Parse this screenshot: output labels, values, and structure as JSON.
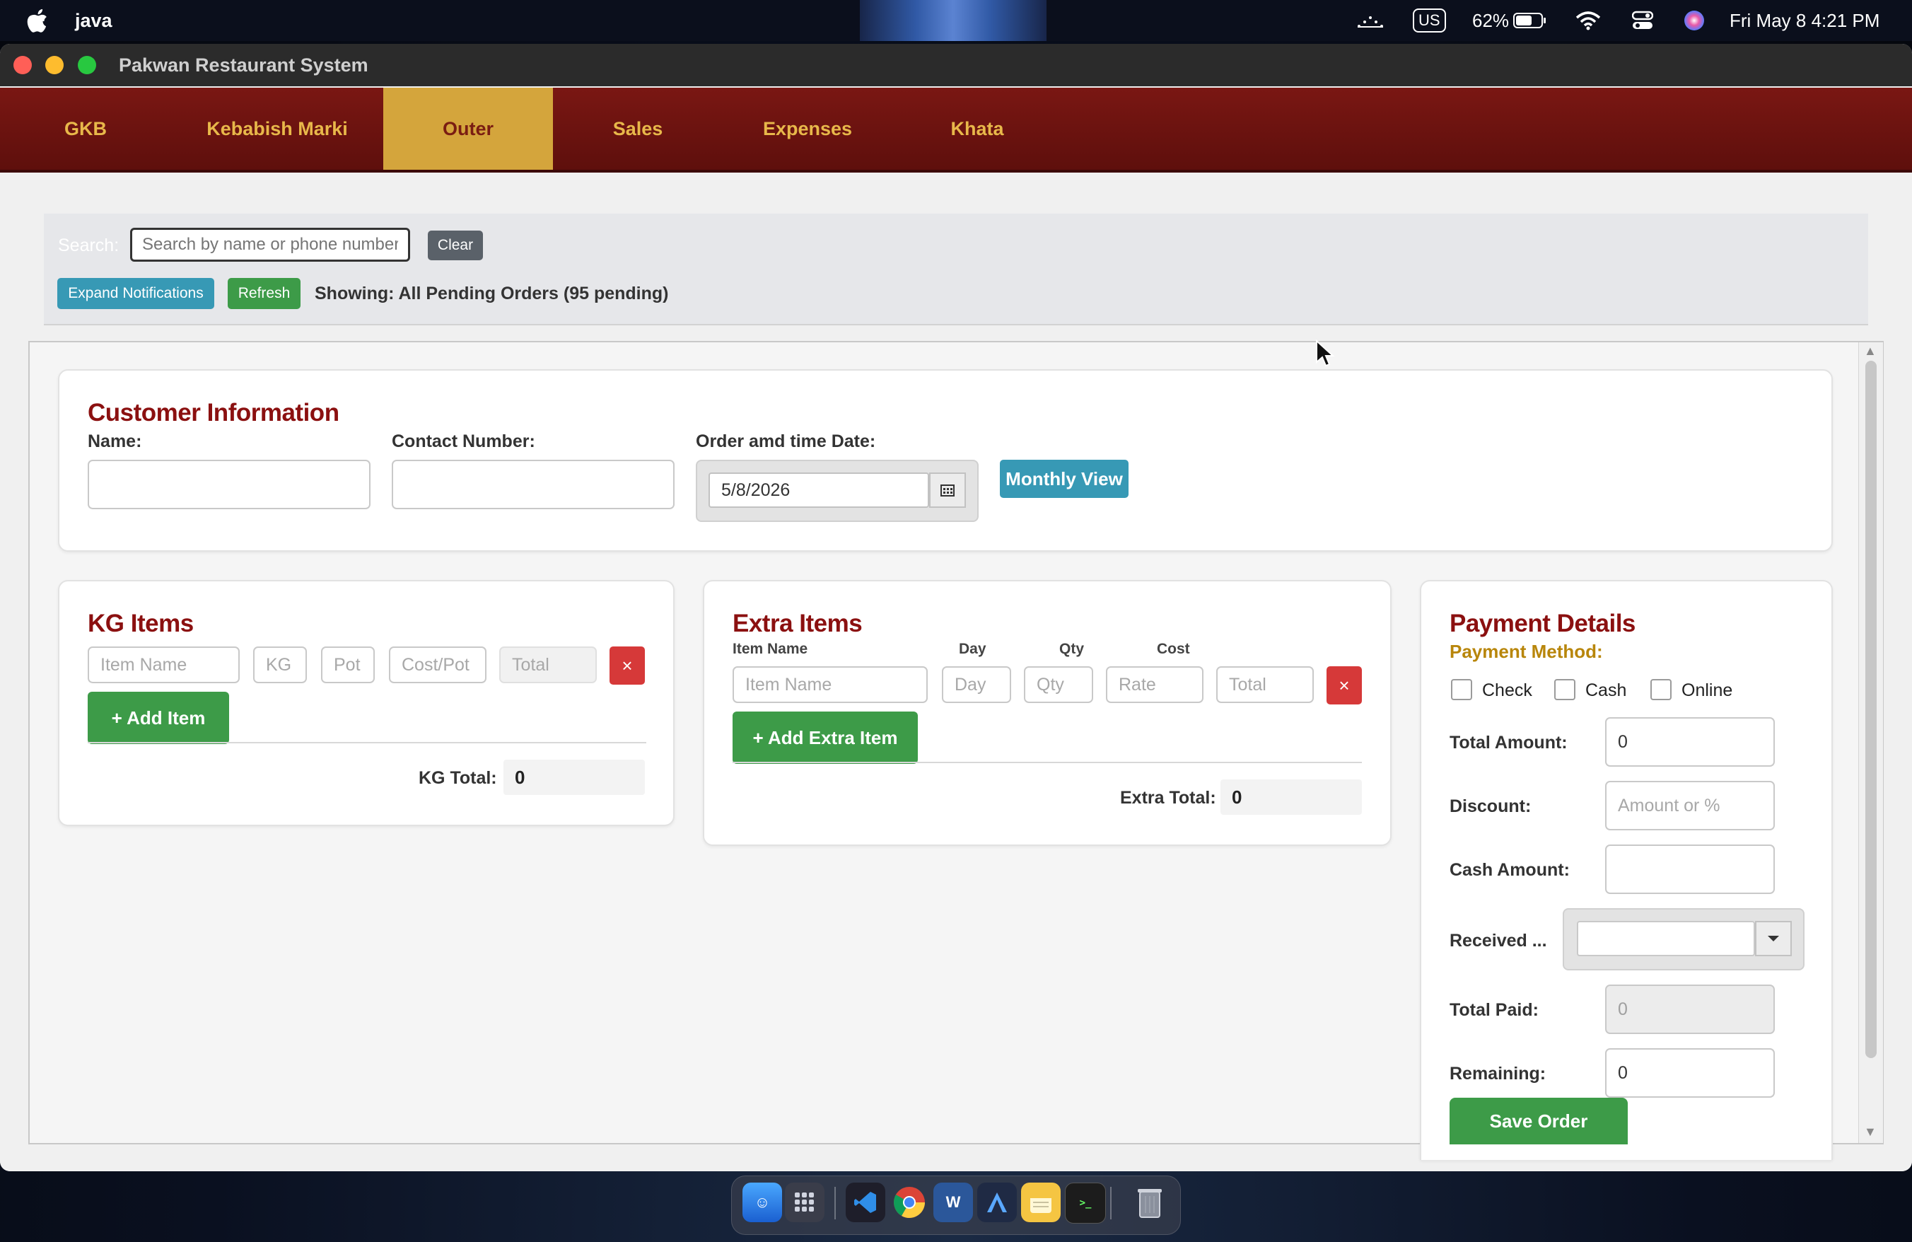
{
  "menubar": {
    "apple": "",
    "app_name": "java",
    "keyboard": "US",
    "battery": "62%",
    "datetime": "Fri May 8  4:21 PM"
  },
  "window": {
    "title": "Pakwan Restaurant System",
    "tabs": [
      {
        "label": "GKB"
      },
      {
        "label": "Kebabish Marki"
      },
      {
        "label": "Outer",
        "active": true
      },
      {
        "label": "Sales"
      },
      {
        "label": "Expenses"
      },
      {
        "label": "Khata"
      }
    ]
  },
  "search": {
    "label": "Search:",
    "placeholder": "Search by name or phone number...",
    "value": "",
    "clear_label": "Clear",
    "expand_label": "Expand Notifications",
    "refresh_label": "Refresh",
    "status": "Showing: All Pending Orders (95 pending)"
  },
  "customer": {
    "heading": "Customer Information",
    "name_label": "Name:",
    "name_value": "",
    "contact_label": "Contact Number:",
    "contact_value": "",
    "date_label": "Order amd time  Date:",
    "date_value": "5/8/2026",
    "monthly_label": "Monthly View"
  },
  "kg": {
    "heading": "KG Items",
    "ph_item": "Item Name",
    "ph_kg": "KG",
    "ph_pot": "Pot",
    "ph_cost": "Cost/Pot",
    "ph_total": "Total",
    "delete": "×",
    "add_label": "+ Add Item",
    "total_label": "KG Total:",
    "total_value": "0"
  },
  "extra": {
    "heading": "Extra Items",
    "col_item": "Item Name",
    "col_day": "Day",
    "col_qty": "Qty",
    "col_cost": "Cost",
    "ph_item": "Item Name",
    "ph_day": "Day",
    "ph_qty": "Qty",
    "ph_rate": "Rate",
    "ph_total": "Total",
    "delete": "×",
    "add_label": "+ Add Extra Item",
    "total_label": "Extra Total:",
    "total_value": "0"
  },
  "payment": {
    "heading": "Payment Details",
    "method_label": "Payment Method:",
    "methods": [
      "Check",
      "Cash",
      "Online"
    ],
    "total_label": "Total Amount:",
    "total_value": "0",
    "discount_label": "Discount:",
    "discount_ph": "Amount or %",
    "cash_label": "Cash Amount:",
    "cash_value": "",
    "received_label": "Received ...",
    "received_value": "",
    "paid_label": "Total Paid:",
    "paid_value": "0",
    "remaining_label": "Remaining:",
    "remaining_value": "0",
    "save_label": "Save Order"
  },
  "colors": {
    "tab_bar": "#6b1410",
    "tab_active": "#d4a53c",
    "heading": "#8b1010",
    "green": "#3d9b48",
    "blue": "#3799b5",
    "danger": "#d63939"
  }
}
